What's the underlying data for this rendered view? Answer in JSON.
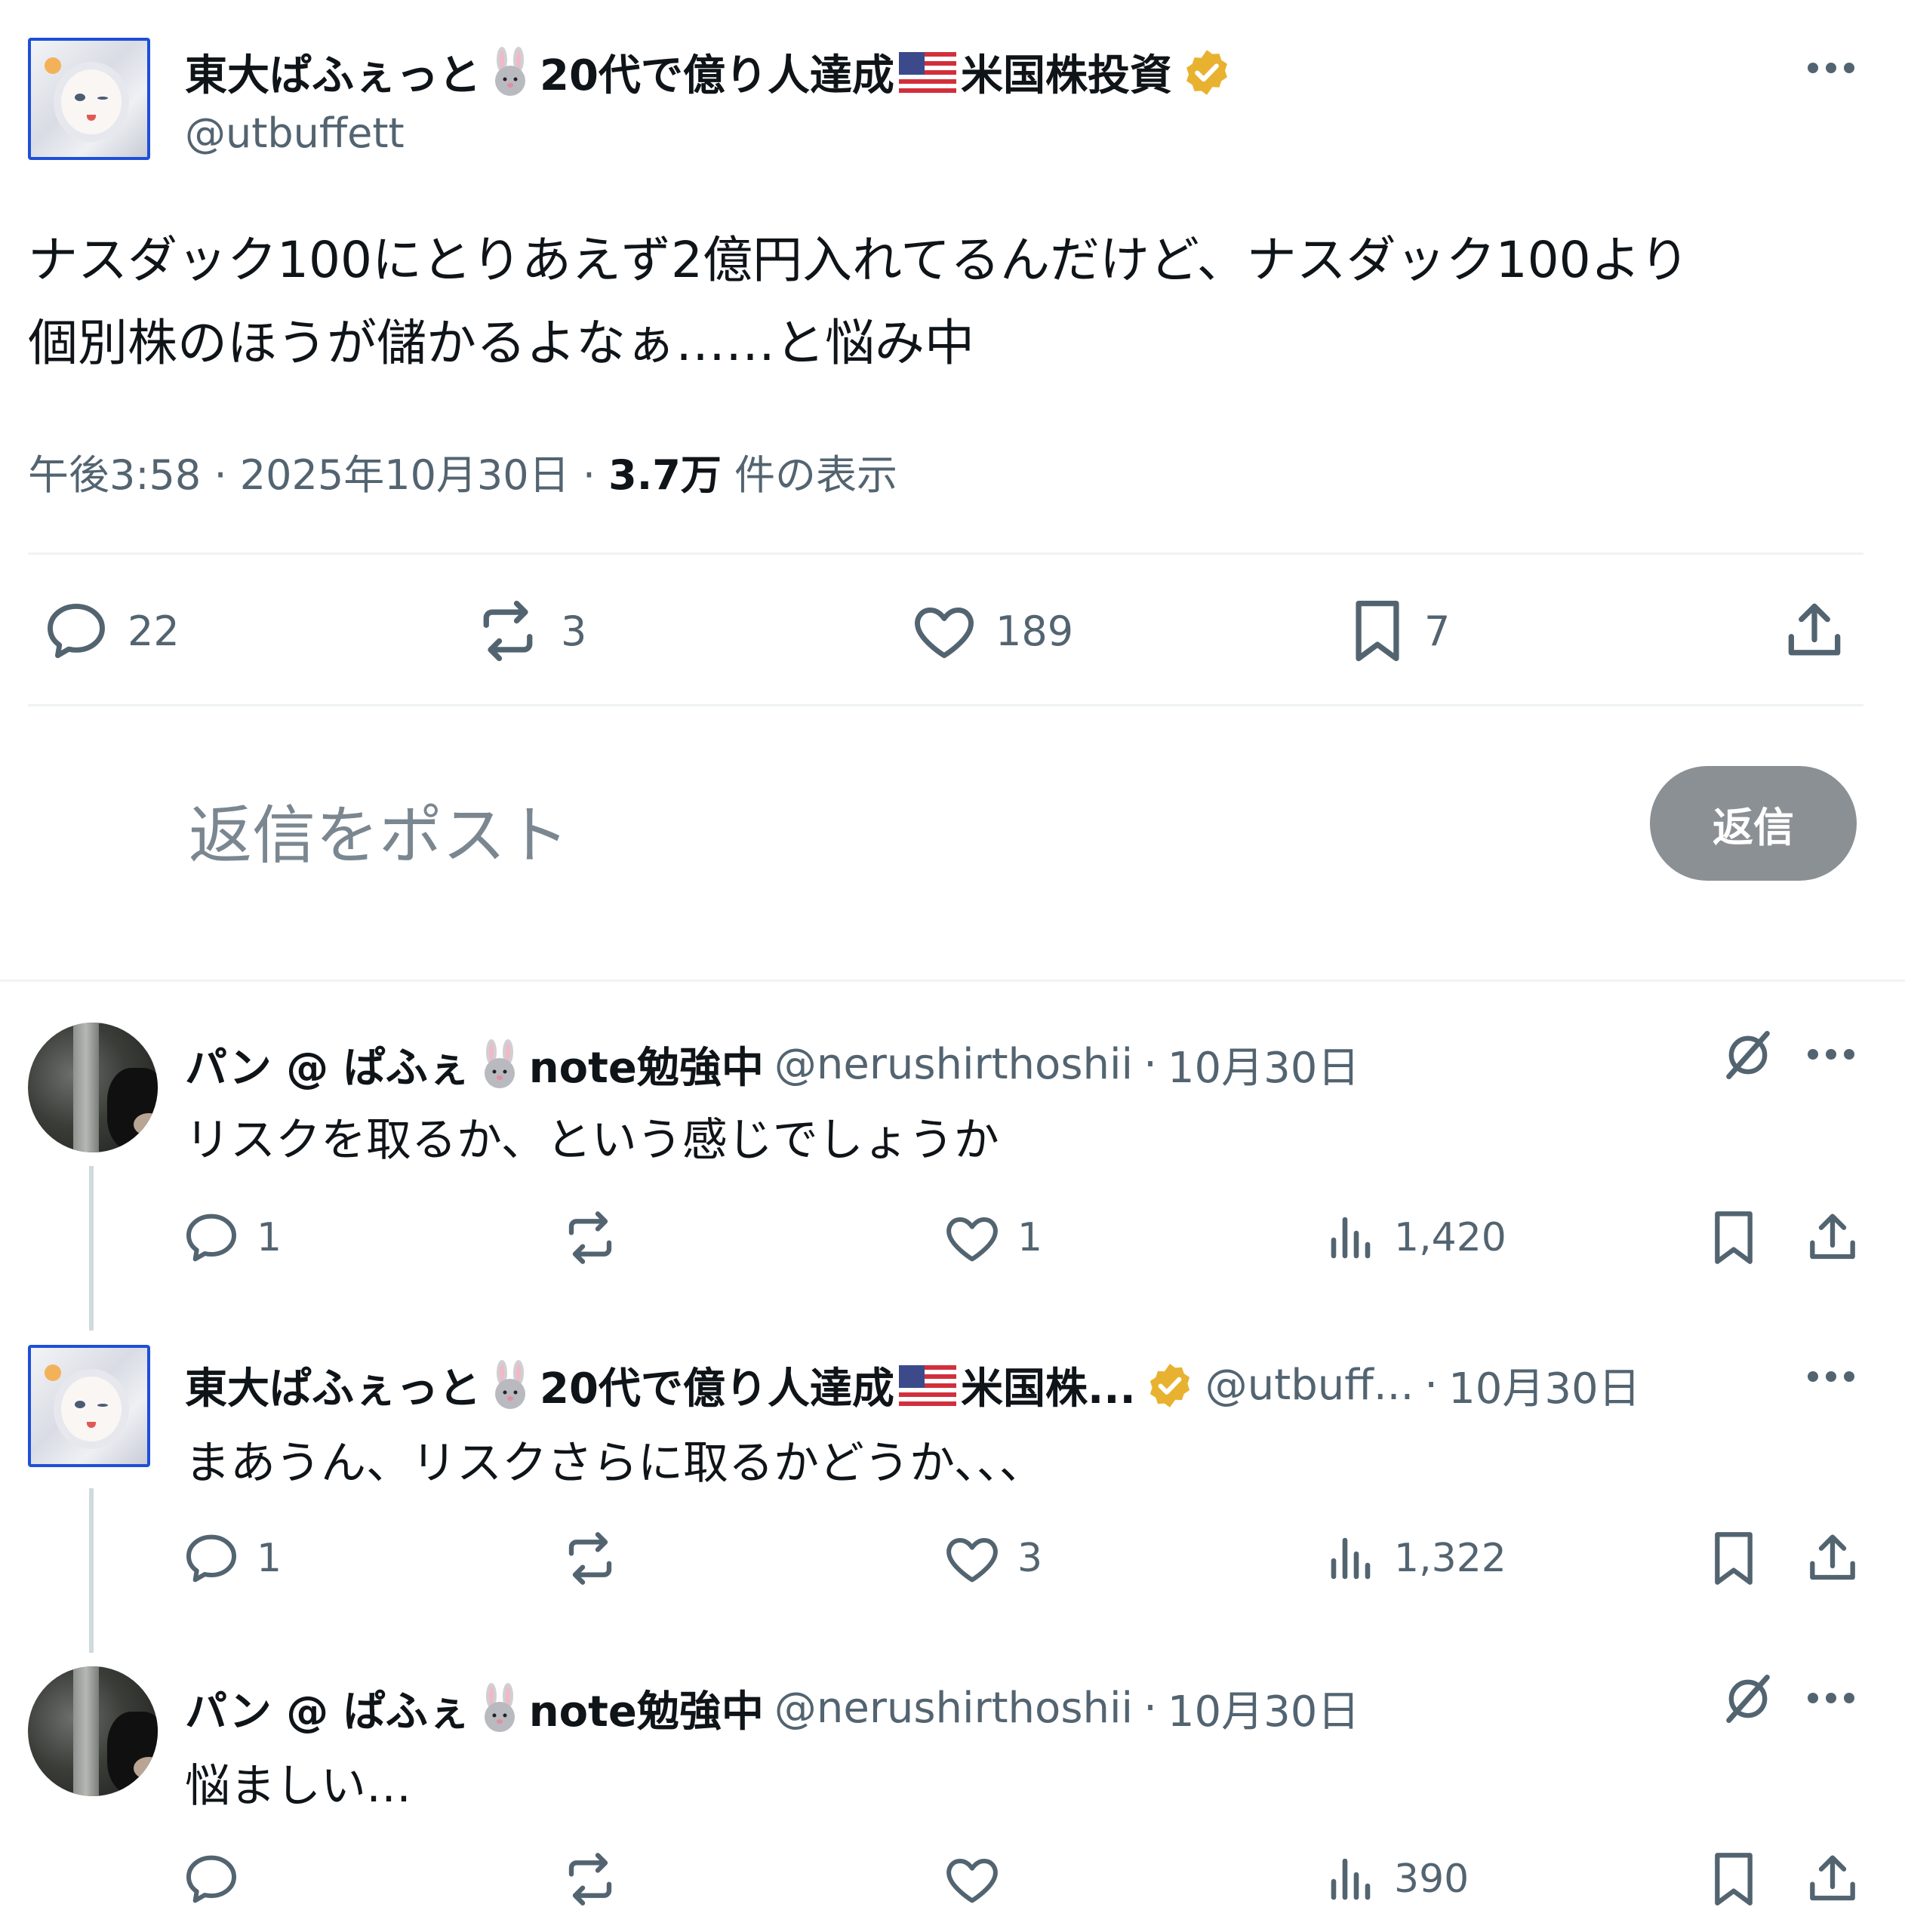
{
  "main_tweet": {
    "author_name_part1": "東大ぱふぇっと",
    "author_name_part2": "20代で億り人達成",
    "author_name_part3": "米国株投資",
    "handle": "@utbuffett",
    "text_line1": "ナスダック100にとりあえず2億円入れてるんだけど、ナスダック100より",
    "text_line2": "個別株のほうが儲かるよなぁ……と悩み中",
    "time": "午後3:58",
    "date": "2025年10月30日",
    "views_value": "3.7万",
    "views_label": "件の表示",
    "separator": "·",
    "replies": "22",
    "reposts": "3",
    "likes": "189",
    "bookmarks": "7"
  },
  "reply_box": {
    "placeholder": "返信をポスト",
    "button_label": "返信"
  },
  "replies": [
    {
      "name_part1": "パン @ ぱふぇ",
      "name_part2": "note勉強中",
      "handle": "@nerushirthoshii",
      "date": "10月30日",
      "text": "リスクを取るか、という感じでしょうか",
      "replies": "1",
      "reposts": "",
      "likes": "1",
      "views": "1,420"
    },
    {
      "name_part1": "東大ぱふぇっと",
      "name_part2": "20代で億り人達成",
      "name_part3": "米国株...",
      "handle": "@utbuff...",
      "date": "10月30日",
      "text": "まあうん、リスクさらに取るかどうか、、、",
      "replies": "1",
      "reposts": "",
      "likes": "3",
      "views": "1,322"
    },
    {
      "name_part1": "パン @ ぱふぇ",
      "name_part2": "note勉強中",
      "handle": "@nerushirthoshii",
      "date": "10月30日",
      "text": "悩ましい…",
      "replies": "",
      "reposts": "",
      "likes": "",
      "views": "390"
    }
  ],
  "colors": {
    "text_primary": "#0f1419",
    "text_secondary": "#536471",
    "verified_gold": "#e8b230",
    "reply_button_bg": "#8b9094",
    "divider": "#eff3f4"
  },
  "icons": [
    "more-icon",
    "rabbit-emoji-icon",
    "us-flag-icon",
    "verified-badge-icon",
    "reply-icon",
    "repost-icon",
    "like-icon",
    "bookmark-icon",
    "share-icon",
    "views-icon",
    "grok-icon"
  ]
}
